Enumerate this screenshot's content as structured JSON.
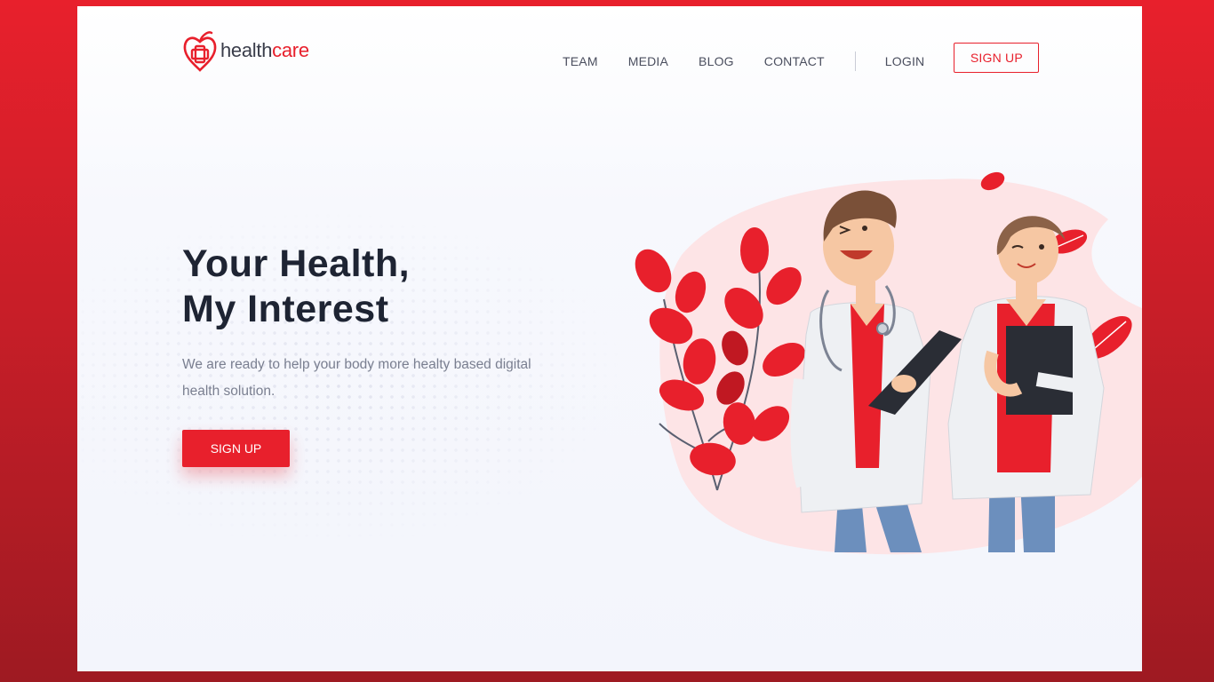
{
  "brand": {
    "part1": "health",
    "part2": "care",
    "accent": "#e8202c"
  },
  "nav": {
    "items": [
      {
        "label": "TEAM"
      },
      {
        "label": "MEDIA"
      },
      {
        "label": "BLOG"
      },
      {
        "label": "CONTACT"
      }
    ],
    "login_label": "LOGIN",
    "signup_label": "SIGN UP"
  },
  "hero": {
    "title_line1": "Your Health,",
    "title_line2": "My Interest",
    "subtitle": "We are ready to help your body more healty based digital health solution.",
    "cta_label": "SIGN UP"
  },
  "colors": {
    "accent": "#e8202c",
    "heading": "#1e2433",
    "body_text": "#7a7f90",
    "blob": "#fde4e6"
  }
}
